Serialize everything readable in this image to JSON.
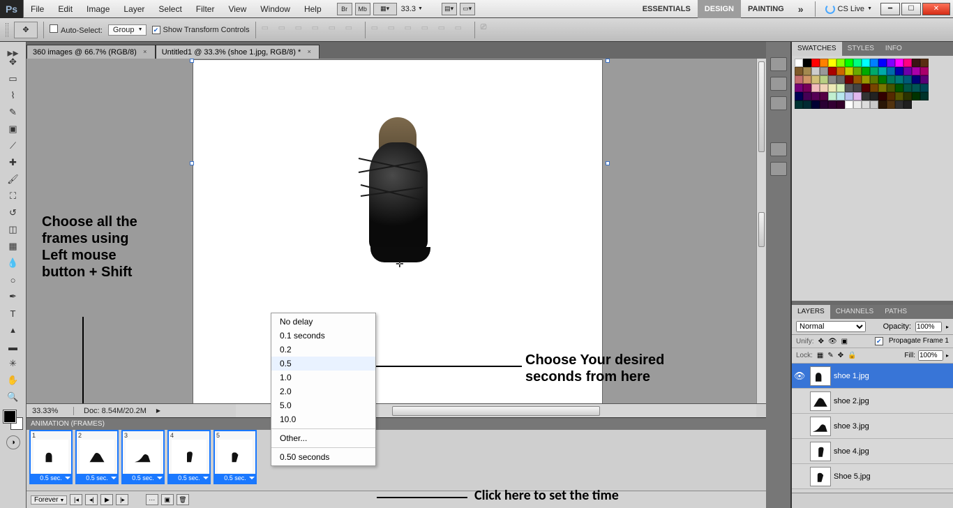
{
  "menubar": {
    "items": [
      "File",
      "Edit",
      "Image",
      "Layer",
      "Select",
      "Filter",
      "View",
      "Window",
      "Help"
    ],
    "br": "Br",
    "mb": "Mb",
    "zoom": "33.3",
    "workspaces": [
      "ESSENTIALS",
      "DESIGN",
      "PAINTING"
    ],
    "ws_active": 1,
    "cslive": "CS Live"
  },
  "optbar": {
    "auto_select": "Auto-Select:",
    "auto_select_mode": "Group",
    "show_transform": "Show Transform Controls"
  },
  "doc_tabs": [
    {
      "label": "360 images @ 66.7% (RGB/8)",
      "active": false
    },
    {
      "label": "Untitled1 @ 33.3% (shoe 1.jpg, RGB/8) *",
      "active": true
    }
  ],
  "status": {
    "zoom": "33.33%",
    "doc": "Doc: 8.54M/20.2M"
  },
  "animation": {
    "title": "ANIMATION (FRAMES)",
    "loop": "Forever",
    "frames": [
      {
        "n": "1",
        "sec": "0.5 sec."
      },
      {
        "n": "2",
        "sec": "0.5 sec."
      },
      {
        "n": "3",
        "sec": "0.5 sec."
      },
      {
        "n": "4",
        "sec": "0.5 sec."
      },
      {
        "n": "5",
        "sec": "0.5 sec."
      }
    ]
  },
  "delay_menu": {
    "items": [
      "No delay",
      "0.1 seconds",
      "0.2",
      "0.5",
      "1.0",
      "2.0",
      "5.0",
      "10.0"
    ],
    "other": "Other...",
    "current": "0.50 seconds",
    "selected_index": 3
  },
  "annotations": {
    "left1": "Choose all the",
    "left2": "frames using",
    "left3": "Left mouse",
    "left4": "button + Shift",
    "right1": "Choose Your desired",
    "right2": "seconds from here",
    "bottom": "Click here to set the time"
  },
  "panels": {
    "swatches_tabs": [
      "SWATCHES",
      "STYLES",
      "INFO"
    ],
    "sw_active": 0,
    "layers_tabs": [
      "LAYERS",
      "CHANNELS",
      "PATHS"
    ],
    "layers_active": 0
  },
  "layers": {
    "mode": "Normal",
    "opacity_label": "Opacity:",
    "opacity": "100%",
    "unify": "Unify:",
    "propagate": "Propagate Frame 1",
    "lock": "Lock:",
    "fill_label": "Fill:",
    "fill": "100%",
    "items": [
      {
        "name": "shoe 1.jpg",
        "selected": true,
        "visible": true
      },
      {
        "name": "shoe 2.jpg",
        "selected": false,
        "visible": false
      },
      {
        "name": "shoe 3.jpg",
        "selected": false,
        "visible": false
      },
      {
        "name": "shoe 4.jpg",
        "selected": false,
        "visible": false
      },
      {
        "name": "Shoe 5.jpg",
        "selected": false,
        "visible": false
      }
    ]
  },
  "swatch_colors": [
    "#ffffff",
    "#000000",
    "#ff0000",
    "#ff8000",
    "#ffff00",
    "#86ff00",
    "#00ff00",
    "#00ff80",
    "#00ffff",
    "#0080ff",
    "#0000ff",
    "#8000ff",
    "#ff00ff",
    "#ff0080",
    "#3a1414",
    "#5a2e12",
    "#7f5a2a",
    "#a4894f",
    "#cccccc",
    "#999999",
    "#aa0000",
    "#cc6600",
    "#cccc00",
    "#6baa00",
    "#00aa00",
    "#00aa6b",
    "#00aaaa",
    "#006baa",
    "#0000aa",
    "#6b00aa",
    "#aa00aa",
    "#aa006b",
    "#c46e6e",
    "#cf9466",
    "#d2c078",
    "#b9cf84",
    "#888888",
    "#666666",
    "#770000",
    "#995500",
    "#999900",
    "#5a7700",
    "#007700",
    "#00775a",
    "#007777",
    "#005a77",
    "#000077",
    "#5a0077",
    "#770077",
    "#77005a",
    "#f2bcbc",
    "#f1d3b8",
    "#edeab6",
    "#d6efb6",
    "#555555",
    "#444444",
    "#550000",
    "#774400",
    "#777700",
    "#455500",
    "#005500",
    "#005545",
    "#005555",
    "#004555",
    "#000055",
    "#450055",
    "#550055",
    "#550045",
    "#c1efd0",
    "#b8e7ee",
    "#b9c3ef",
    "#e1b8ef",
    "#333333",
    "#222222",
    "#330000",
    "#552a00",
    "#555500",
    "#2a3300",
    "#003300",
    "#00332a",
    "#003333",
    "#002a33",
    "#000033",
    "#2a0033",
    "#330033",
    "#33002a",
    "#ffffff",
    "#ececec",
    "#dcdcdc",
    "#cacaca",
    "#2a1706",
    "#52330f",
    "#2f2f2f",
    "#1f1f1f"
  ]
}
